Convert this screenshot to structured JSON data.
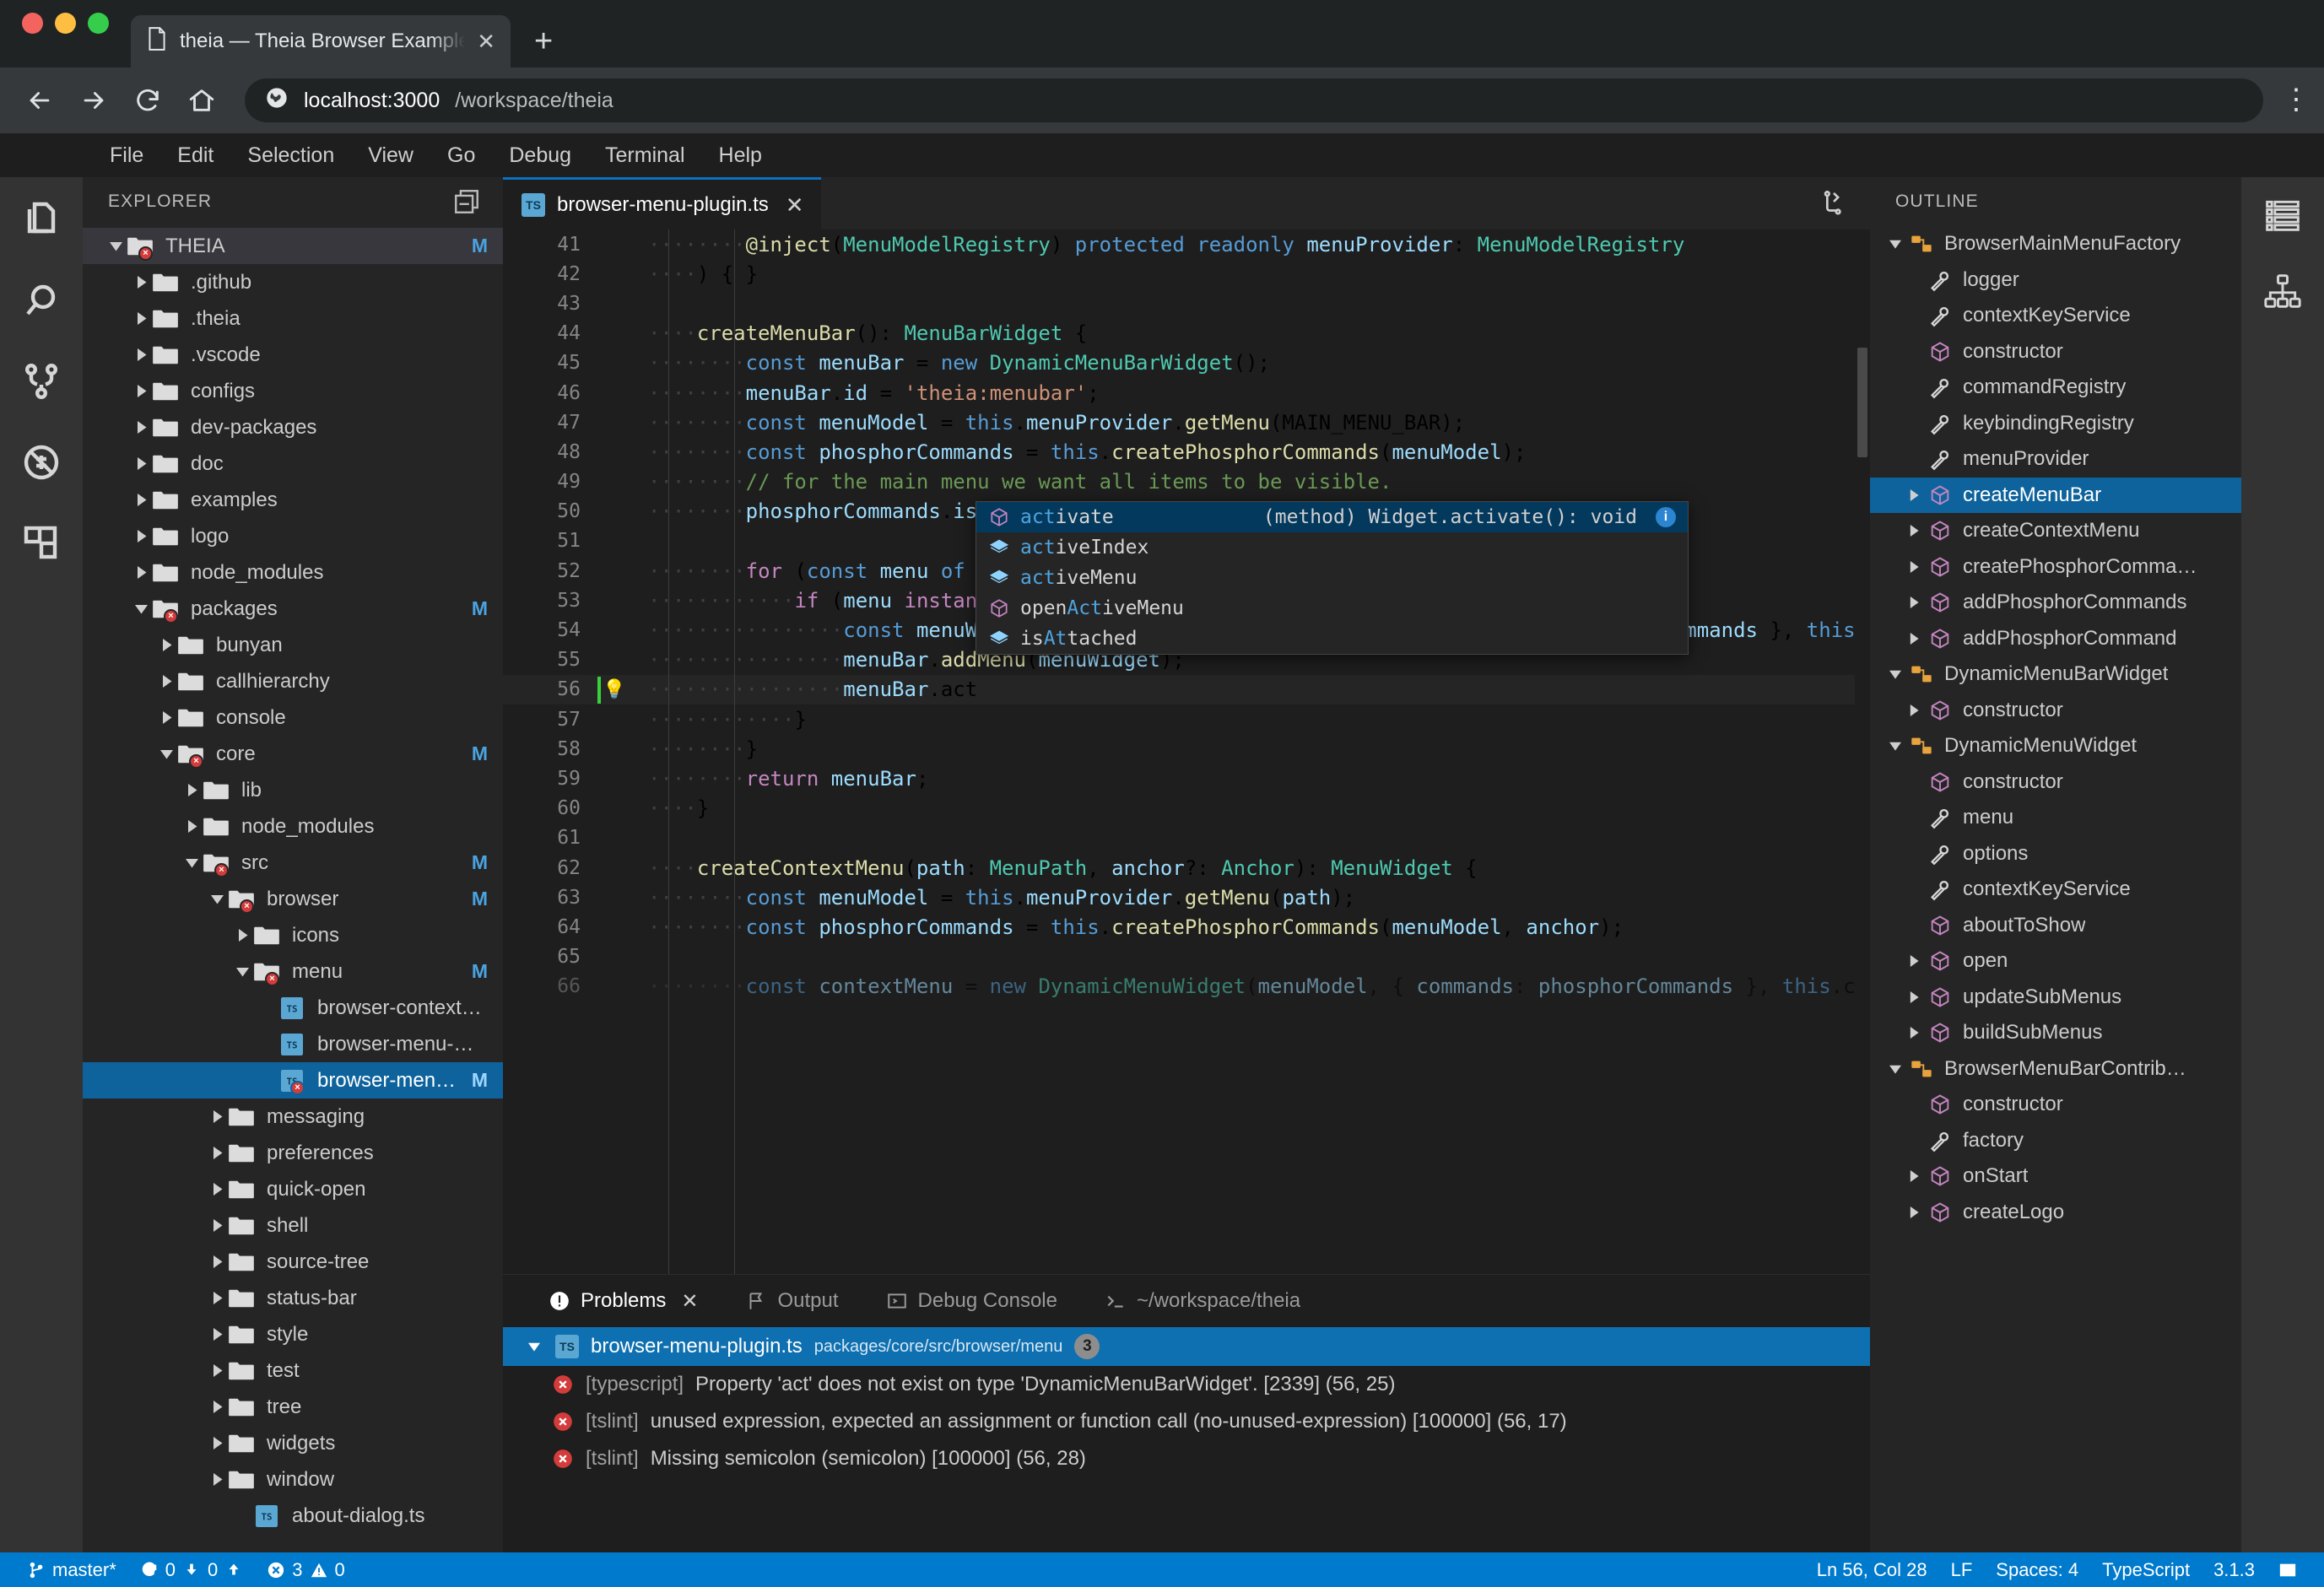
{
  "browser": {
    "tab": {
      "title": "theia — Theia Browser Example",
      "icon": "document-icon",
      "close_label": "✕"
    },
    "new_tab_label": "+",
    "url_host": "localhost:3000",
    "url_rest": "/workspace/theia",
    "menu_label": "⋮"
  },
  "menubar": {
    "items": [
      "File",
      "Edit",
      "Selection",
      "View",
      "Go",
      "Debug",
      "Terminal",
      "Help"
    ]
  },
  "activitybar_left": [
    {
      "name": "files-icon",
      "title": "Explorer"
    },
    {
      "name": "search-icon",
      "title": "Search"
    },
    {
      "name": "source-control-icon",
      "title": "Source Control"
    },
    {
      "name": "debug-icon",
      "title": "Debug"
    },
    {
      "name": "extensions-icon",
      "title": "Extensions"
    }
  ],
  "activitybar_right": [
    {
      "name": "outline-list-icon",
      "title": "Outline"
    },
    {
      "name": "hierarchy-icon",
      "title": "Call Hierarchy"
    }
  ],
  "explorer": {
    "title": "EXPLORER",
    "action_icon": "collapse-all-icon",
    "tree": [
      {
        "label": "THEIA",
        "depth": 0,
        "type": "folder",
        "state": "open",
        "badge": "M",
        "error": true,
        "root": true
      },
      {
        "label": ".github",
        "depth": 1,
        "type": "folder",
        "state": "closed",
        "badge": "",
        "error": false
      },
      {
        "label": ".theia",
        "depth": 1,
        "type": "folder",
        "state": "closed",
        "badge": "",
        "error": false
      },
      {
        "label": ".vscode",
        "depth": 1,
        "type": "folder",
        "state": "closed",
        "badge": "",
        "error": false
      },
      {
        "label": "configs",
        "depth": 1,
        "type": "folder",
        "state": "closed",
        "badge": "",
        "error": false
      },
      {
        "label": "dev-packages",
        "depth": 1,
        "type": "folder",
        "state": "closed",
        "badge": "",
        "error": false
      },
      {
        "label": "doc",
        "depth": 1,
        "type": "folder",
        "state": "closed",
        "badge": "",
        "error": false
      },
      {
        "label": "examples",
        "depth": 1,
        "type": "folder",
        "state": "closed",
        "badge": "",
        "error": false
      },
      {
        "label": "logo",
        "depth": 1,
        "type": "folder",
        "state": "closed",
        "badge": "",
        "error": false
      },
      {
        "label": "node_modules",
        "depth": 1,
        "type": "folder",
        "state": "closed",
        "badge": "",
        "error": false
      },
      {
        "label": "packages",
        "depth": 1,
        "type": "folder",
        "state": "open",
        "badge": "M",
        "error": true
      },
      {
        "label": "bunyan",
        "depth": 2,
        "type": "folder",
        "state": "closed",
        "badge": "",
        "error": false
      },
      {
        "label": "callhierarchy",
        "depth": 2,
        "type": "folder",
        "state": "closed",
        "badge": "",
        "error": false
      },
      {
        "label": "console",
        "depth": 2,
        "type": "folder",
        "state": "closed",
        "badge": "",
        "error": false
      },
      {
        "label": "core",
        "depth": 2,
        "type": "folder",
        "state": "open",
        "badge": "M",
        "error": true
      },
      {
        "label": "lib",
        "depth": 3,
        "type": "folder",
        "state": "closed",
        "badge": "",
        "error": false
      },
      {
        "label": "node_modules",
        "depth": 3,
        "type": "folder",
        "state": "closed",
        "badge": "",
        "error": false
      },
      {
        "label": "src",
        "depth": 3,
        "type": "folder",
        "state": "open",
        "badge": "M",
        "error": true
      },
      {
        "label": "browser",
        "depth": 4,
        "type": "folder",
        "state": "open",
        "badge": "M",
        "error": true
      },
      {
        "label": "icons",
        "depth": 5,
        "type": "folder",
        "state": "closed",
        "badge": "",
        "error": false
      },
      {
        "label": "menu",
        "depth": 5,
        "type": "folder",
        "state": "open",
        "badge": "M",
        "error": true
      },
      {
        "label": "browser-context-menu-r…",
        "depth": 6,
        "type": "ts",
        "state": "none",
        "badge": "",
        "error": false
      },
      {
        "label": "browser-menu-module.ts",
        "depth": 6,
        "type": "ts",
        "state": "none",
        "badge": "",
        "error": false
      },
      {
        "label": "browser-menu-plugin.ts",
        "depth": 6,
        "type": "ts",
        "state": "none",
        "badge": "M",
        "error": true,
        "selected": true
      },
      {
        "label": "messaging",
        "depth": 4,
        "type": "folder",
        "state": "closed",
        "badge": "",
        "error": false
      },
      {
        "label": "preferences",
        "depth": 4,
        "type": "folder",
        "state": "closed",
        "badge": "",
        "error": false
      },
      {
        "label": "quick-open",
        "depth": 4,
        "type": "folder",
        "state": "closed",
        "badge": "",
        "error": false
      },
      {
        "label": "shell",
        "depth": 4,
        "type": "folder",
        "state": "closed",
        "badge": "",
        "error": false
      },
      {
        "label": "source-tree",
        "depth": 4,
        "type": "folder",
        "state": "closed",
        "badge": "",
        "error": false
      },
      {
        "label": "status-bar",
        "depth": 4,
        "type": "folder",
        "state": "closed",
        "badge": "",
        "error": false
      },
      {
        "label": "style",
        "depth": 4,
        "type": "folder",
        "state": "closed",
        "badge": "",
        "error": false
      },
      {
        "label": "test",
        "depth": 4,
        "type": "folder",
        "state": "closed",
        "badge": "",
        "error": false
      },
      {
        "label": "tree",
        "depth": 4,
        "type": "folder",
        "state": "closed",
        "badge": "",
        "error": false
      },
      {
        "label": "widgets",
        "depth": 4,
        "type": "folder",
        "state": "closed",
        "badge": "",
        "error": false
      },
      {
        "label": "window",
        "depth": 4,
        "type": "folder",
        "state": "closed",
        "badge": "",
        "error": false
      },
      {
        "label": "about-dialog.ts",
        "depth": 5,
        "type": "ts",
        "state": "none",
        "badge": "",
        "error": false
      }
    ]
  },
  "editor": {
    "tab": {
      "label": "browser-menu-plugin.ts",
      "close": "✕",
      "badge": "TS"
    },
    "sync_icon": "sync-icon",
    "first_line": 41,
    "cursor_line": 56,
    "lines": [
      {
        "n": 41,
        "text": "        @inject(MenuModelRegistry) protected readonly menuProvider: MenuModelRegistry"
      },
      {
        "n": 42,
        "text": "    ) { }"
      },
      {
        "n": 43,
        "text": ""
      },
      {
        "n": 44,
        "text": "    createMenuBar(): MenuBarWidget {"
      },
      {
        "n": 45,
        "text": "        const menuBar = new DynamicMenuBarWidget();"
      },
      {
        "n": 46,
        "text": "        menuBar.id = 'theia:menubar';"
      },
      {
        "n": 47,
        "text": "        const menuModel = this.menuProvider.getMenu(MAIN_MENU_BAR);"
      },
      {
        "n": 48,
        "text": "        const phosphorCommands = this.createPhosphorCommands(menuModel);"
      },
      {
        "n": 49,
        "text": "        // for the main menu we want all items to be visible."
      },
      {
        "n": 50,
        "text": "        phosphorCommands.isVisible = () => true;"
      },
      {
        "n": 51,
        "text": ""
      },
      {
        "n": 52,
        "text": "        for (const menu of menuModel.children) {"
      },
      {
        "n": 53,
        "text": "            if (menu instanceof CompositeMenuNode) {"
      },
      {
        "n": 54,
        "text": "                const menuWidget = new DynamicMenuWidget(menu, { commands: phosphorCommands }, this.co"
      },
      {
        "n": 55,
        "text": "                menuBar.addMenu(menuWidget);"
      },
      {
        "n": 56,
        "text": "                menuBar.act"
      },
      {
        "n": 57,
        "text": "            }"
      },
      {
        "n": 58,
        "text": "        }"
      },
      {
        "n": 59,
        "text": "        return menuBar;"
      },
      {
        "n": 60,
        "text": "    }"
      },
      {
        "n": 61,
        "text": ""
      },
      {
        "n": 62,
        "text": "    createContextMenu(path: MenuPath, anchor?: Anchor): MenuWidget {"
      },
      {
        "n": 63,
        "text": "        const menuModel = this.menuProvider.getMenu(path);"
      },
      {
        "n": 64,
        "text": "        const phosphorCommands = this.createPhosphorCommands(menuModel, anchor);"
      },
      {
        "n": 65,
        "text": ""
      },
      {
        "n": 66,
        "text": "        const contextMenu = new DynamicMenuWidget(menuModel, { commands: phosphorCommands }, this.cont"
      }
    ]
  },
  "autocomplete": {
    "items": [
      {
        "label": "activate",
        "prefix": "act",
        "icon": "method-icon",
        "detail": "(method) Widget.activate(): void",
        "selected": true,
        "info": "i"
      },
      {
        "label": "activeIndex",
        "prefix": "act",
        "icon": "property-icon",
        "detail": "",
        "selected": false
      },
      {
        "label": "activeMenu",
        "prefix": "act",
        "icon": "property-icon",
        "detail": "",
        "selected": false
      },
      {
        "label": "openActiveMenu",
        "prefix": "",
        "icon": "method-icon",
        "detail": "",
        "selected": false,
        "highlight": "Act"
      },
      {
        "label": "isAttached",
        "prefix": "",
        "icon": "property-icon",
        "detail": "",
        "selected": false,
        "highlight": "At"
      }
    ]
  },
  "bottom_panel": {
    "tabs": [
      {
        "label": "Problems",
        "icon": "warning-circle-icon",
        "active": true,
        "closable": true
      },
      {
        "label": "Output",
        "icon": "flag-icon",
        "active": false,
        "closable": false
      },
      {
        "label": "Debug Console",
        "icon": "console-icon",
        "active": false,
        "closable": false
      },
      {
        "label": "~/workspace/theia",
        "icon": "terminal-icon",
        "active": false,
        "closable": false
      }
    ],
    "file_group": {
      "filename": "browser-menu-plugin.ts",
      "path": "packages/core/src/browser/menu",
      "count": "3",
      "badge": "TS"
    },
    "problems": [
      {
        "source": "[typescript]",
        "message": "Property 'act' does not exist on type 'DynamicMenuBarWidget'. [2339] (56, 25)",
        "severity": "error"
      },
      {
        "source": "[tslint]",
        "message": "unused expression, expected an assignment or function call (no-unused-expression) [100000] (56, 17)",
        "severity": "error"
      },
      {
        "source": "[tslint]",
        "message": "Missing semicolon (semicolon) [100000] (56, 28)",
        "severity": "error"
      }
    ]
  },
  "outline": {
    "title": "OUTLINE",
    "items": [
      {
        "label": "BrowserMainMenuFactory",
        "depth": 0,
        "icon": "class-icon",
        "state": "open"
      },
      {
        "label": "logger",
        "depth": 1,
        "icon": "property-icon",
        "state": "none"
      },
      {
        "label": "contextKeyService",
        "depth": 1,
        "icon": "property-icon",
        "state": "none"
      },
      {
        "label": "constructor",
        "depth": 1,
        "icon": "method-icon",
        "state": "none"
      },
      {
        "label": "commandRegistry",
        "depth": 1,
        "icon": "property-icon",
        "state": "none"
      },
      {
        "label": "keybindingRegistry",
        "depth": 1,
        "icon": "property-icon",
        "state": "none"
      },
      {
        "label": "menuProvider",
        "depth": 1,
        "icon": "property-icon",
        "state": "none"
      },
      {
        "label": "createMenuBar",
        "depth": 1,
        "icon": "method-icon",
        "state": "closed",
        "selected": true
      },
      {
        "label": "createContextMenu",
        "depth": 1,
        "icon": "method-icon",
        "state": "closed"
      },
      {
        "label": "createPhosphorComma…",
        "depth": 1,
        "icon": "method-icon",
        "state": "closed"
      },
      {
        "label": "addPhosphorCommands",
        "depth": 1,
        "icon": "method-icon",
        "state": "closed"
      },
      {
        "label": "addPhosphorCommand",
        "depth": 1,
        "icon": "method-icon",
        "state": "closed"
      },
      {
        "label": "DynamicMenuBarWidget",
        "depth": 0,
        "icon": "class-icon",
        "state": "open"
      },
      {
        "label": "constructor",
        "depth": 1,
        "icon": "method-icon",
        "state": "closed"
      },
      {
        "label": "DynamicMenuWidget",
        "depth": 0,
        "icon": "class-icon",
        "state": "open"
      },
      {
        "label": "constructor",
        "depth": 1,
        "icon": "method-icon",
        "state": "none"
      },
      {
        "label": "menu",
        "depth": 1,
        "icon": "property-icon",
        "state": "none"
      },
      {
        "label": "options",
        "depth": 1,
        "icon": "property-icon",
        "state": "none"
      },
      {
        "label": "contextKeyService",
        "depth": 1,
        "icon": "property-icon",
        "state": "none"
      },
      {
        "label": "aboutToShow",
        "depth": 1,
        "icon": "method-icon",
        "state": "none"
      },
      {
        "label": "open",
        "depth": 1,
        "icon": "method-icon",
        "state": "closed"
      },
      {
        "label": "updateSubMenus",
        "depth": 1,
        "icon": "method-icon",
        "state": "closed"
      },
      {
        "label": "buildSubMenus",
        "depth": 1,
        "icon": "method-icon",
        "state": "closed"
      },
      {
        "label": "BrowserMenuBarContrib…",
        "depth": 0,
        "icon": "class-icon",
        "state": "open"
      },
      {
        "label": "constructor",
        "depth": 1,
        "icon": "method-icon",
        "state": "none"
      },
      {
        "label": "factory",
        "depth": 1,
        "icon": "property-icon",
        "state": "none"
      },
      {
        "label": "onStart",
        "depth": 1,
        "icon": "method-icon",
        "state": "closed"
      },
      {
        "label": "createLogo",
        "depth": 1,
        "icon": "method-icon",
        "state": "closed"
      }
    ]
  },
  "statusbar": {
    "branch": "master*",
    "sync": "0",
    "down": "0",
    "up": "0",
    "errors": "3",
    "warnings": "0",
    "position": "Ln 56, Col 28",
    "eol": "LF",
    "indent": "Spaces: 4",
    "language": "TypeScript",
    "version": "3.1.3",
    "layout_icon": "layout-icon"
  },
  "colors": {
    "accent": "#007acc",
    "selection": "#0e639c",
    "error": "#d43b3b",
    "badge": "#4aa3e0"
  }
}
